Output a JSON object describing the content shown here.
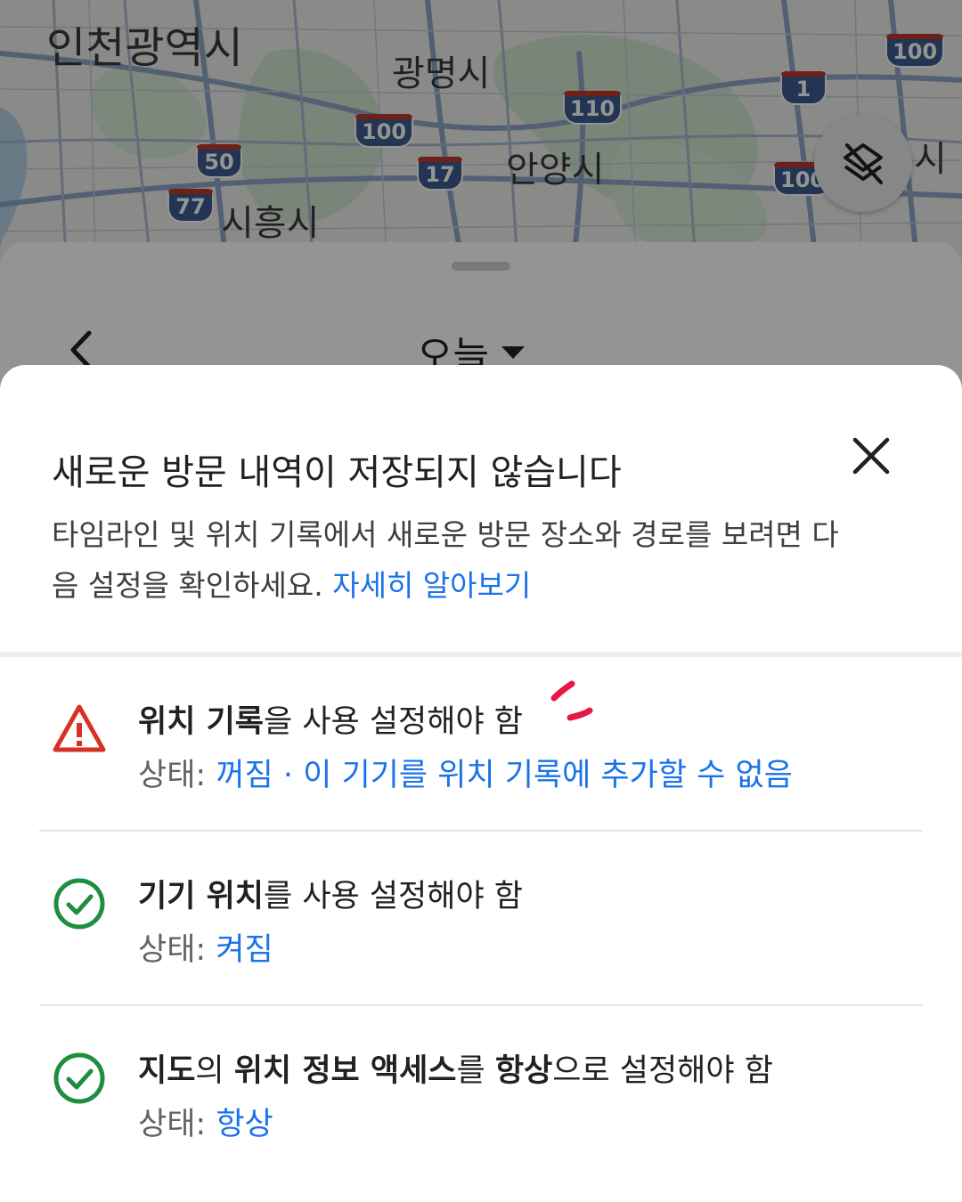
{
  "map": {
    "cities": [
      {
        "name": "인천광역시"
      },
      {
        "name": "광명시"
      },
      {
        "name": "안양시"
      },
      {
        "name": "시흥시"
      },
      {
        "name": "시"
      }
    ],
    "route_shields": [
      "100",
      "110",
      "50",
      "77",
      "17",
      "1",
      "100",
      "100"
    ],
    "layers_button": "layers-off-icon"
  },
  "timeline": {
    "date_label": "오늘"
  },
  "dialog": {
    "title": "새로운 방문 내역이 저장되지 않습니다",
    "description": "타임라인 및 위치 기록에서 새로운 방문 장소와 경로를 보려면 다음 설정을 확인하세요.",
    "learn_more": "자세히 알아보기",
    "requirements": [
      {
        "title_bold_1": "위치 기록",
        "title_rest_1": "을 사용 설정해야 함",
        "status_label": "상태:",
        "status_value": "꺼짐 · 이 기기를 위치 기록에 추가할 수 없음",
        "icon": "warning-icon",
        "icon_color": "#d93025"
      },
      {
        "title_bold_1": "기기 위치",
        "title_rest_1": "를 사용 설정해야 함",
        "status_label": "상태:",
        "status_value": "켜짐",
        "icon": "check-circle-icon",
        "icon_color": "#1e8e3e"
      },
      {
        "title_bold_1": "지도",
        "title_rest_1": "의 ",
        "title_bold_2": "위치 정보 액세스",
        "title_rest_2": "를 ",
        "title_bold_3": "항상",
        "title_rest_3": "으로 설정해야 함",
        "status_label": "상태:",
        "status_value": "항상",
        "icon": "check-circle-icon",
        "icon_color": "#1e8e3e"
      }
    ]
  },
  "colors": {
    "link": "#1a73e8",
    "warning": "#d93025",
    "success": "#1e8e3e",
    "annotation": "#e8174a"
  }
}
